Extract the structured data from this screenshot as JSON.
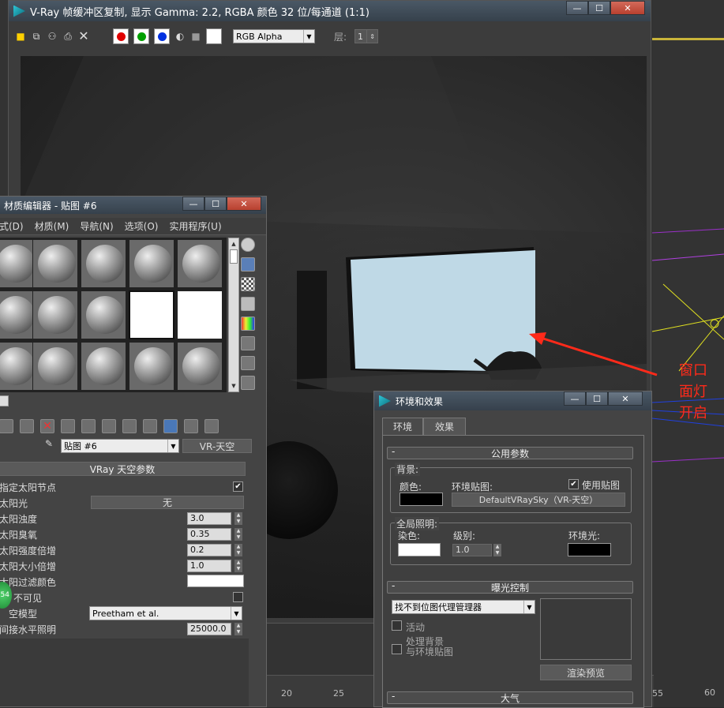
{
  "vray_window": {
    "title": "V-Ray 帧缓冲区复制, 显示 Gamma: 2.2, RGBA 颜色 32 位/每通道 (1:1)",
    "channel_select": "RGB Alpha",
    "layer_label": "层:",
    "layer_value": "1",
    "channel_colors": {
      "red": "#e00000",
      "green": "#00a000",
      "blue": "#0030e0"
    }
  },
  "material_editor": {
    "title": "材质编辑器 - 贴图 #6",
    "menu": [
      "式(D)",
      "材质(M)",
      "导航(N)",
      "选项(O)",
      "实用程序(U)"
    ],
    "map_name": "贴图 #6",
    "map_type": "VR-天空",
    "rollout_title": "VRay 天空参数",
    "params": [
      {
        "label": "指定太阳节点",
        "type": "check",
        "checked": "✔"
      },
      {
        "label": "太阳光",
        "type": "button",
        "value": "无"
      },
      {
        "label": "太阳浊度",
        "type": "spin",
        "value": "3.0"
      },
      {
        "label": "太阳臭氧",
        "type": "spin",
        "value": "0.35"
      },
      {
        "label": "太阳强度倍增",
        "type": "spin",
        "value": "0.2"
      },
      {
        "label": "太阳大小倍增",
        "type": "spin",
        "value": "1.0"
      },
      {
        "label": "太阳过滤颜色",
        "type": "color",
        "value": "#ffffff"
      },
      {
        "label": "不可见",
        "type": "check",
        "checked": ""
      },
      {
        "label": "空模型",
        "type": "combo",
        "value": "Preetham et al."
      },
      {
        "label": "间接水平照明",
        "type": "spin",
        "value": "25000.0"
      }
    ],
    "badge": "54"
  },
  "env_dialog": {
    "title": "环境和效果",
    "tabs": [
      "环境",
      "效果"
    ],
    "common_title": "公用参数",
    "background_label": "背景:",
    "color_label": "颜色:",
    "env_map_label": "环境贴图:",
    "use_map_label": "使用贴图",
    "use_map_checked": "✔",
    "env_map_button": "DefaultVRaySky（VR-天空）",
    "gi_label": "全局照明:",
    "tint_label": "染色:",
    "level_label": "级别:",
    "level_value": "1.0",
    "ambient_label": "环境光:",
    "exposure_title": "曝光控制",
    "exposure_select": "找不到位图代理管理器",
    "active_label": "活动",
    "process_bg_label": "处理背景\n与环境贴图",
    "render_preview": "渲染预览",
    "atmos_title": "大气"
  },
  "annotation": {
    "text_lines": [
      "窗口",
      "面灯",
      "开启"
    ],
    "color": "#ff2a1a"
  },
  "ruler_ticks": [
    "20",
    "25",
    "55",
    "60"
  ]
}
